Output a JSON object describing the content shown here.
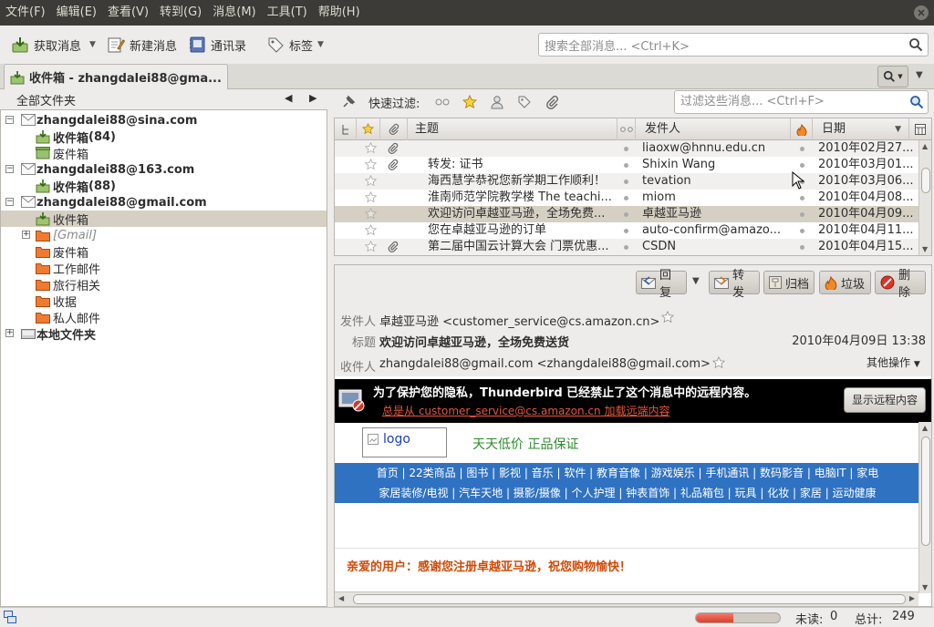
{
  "menubar": {
    "items": [
      "文件(F)",
      "编辑(E)",
      "查看(V)",
      "转到(G)",
      "消息(M)",
      "工具(T)",
      "帮助(H)"
    ]
  },
  "toolbar": {
    "get_messages": "获取消息",
    "new_message": "新建消息",
    "address_book": "通讯录",
    "tags": "标签",
    "search_placeholder": "搜索全部消息... <Ctrl+K>"
  },
  "tab": {
    "title": "收件箱 - zhangdalei88@gma..."
  },
  "folders": {
    "header": "全部文件夹",
    "rows": [
      {
        "label": "zhangdalei88@sina.com",
        "count": ""
      },
      {
        "label": "收件箱",
        "count": " (84)"
      },
      {
        "label": "废件箱",
        "count": ""
      },
      {
        "label": "zhangdalei88@163.com",
        "count": ""
      },
      {
        "label": "收件箱",
        "count": " (88)"
      },
      {
        "label": "zhangdalei88@gmail.com",
        "count": ""
      },
      {
        "label": "收件箱",
        "count": ""
      },
      {
        "label": "[Gmail]",
        "count": ""
      },
      {
        "label": "废件箱",
        "count": ""
      },
      {
        "label": "工作邮件",
        "count": ""
      },
      {
        "label": "旅行相关",
        "count": ""
      },
      {
        "label": "收据",
        "count": ""
      },
      {
        "label": "私人邮件",
        "count": ""
      },
      {
        "label": "本地文件夹",
        "count": ""
      }
    ]
  },
  "quick_filter": {
    "label": "快速过滤:",
    "search_placeholder": "过滤这些消息... <Ctrl+F>"
  },
  "thread_list": {
    "columns": {
      "subject": "主题",
      "sender": "发件人",
      "date": "日期"
    },
    "rows": [
      {
        "subject": "",
        "sender": "liaoxw@hnnu.edu.cn",
        "date": "2010年02月27...",
        "attachment": true
      },
      {
        "subject": "转发: 证书",
        "sender": "Shixin Wang",
        "date": "2010年03月01...",
        "attachment": true
      },
      {
        "subject": "海西慧学恭祝您新学期工作顺利！",
        "sender": "tevation",
        "date": "2010年03月06...",
        "attachment": false
      },
      {
        "subject": "淮南师范学院教学楼 The teachi...",
        "sender": "miom",
        "date": "2010年04月08...",
        "attachment": false
      },
      {
        "subject": "欢迎访问卓越亚马逊，全场免费...",
        "sender": "卓越亚马逊",
        "date": "2010年04月09...",
        "attachment": false
      },
      {
        "subject": "您在卓越亚马逊的订单",
        "sender": "auto-confirm@amazo...",
        "date": "2010年04月11...",
        "attachment": false
      },
      {
        "subject": "第二届中国云计算大会 门票优惠...",
        "sender": "CSDN",
        "date": "2010年04月15...",
        "attachment": true
      }
    ]
  },
  "message": {
    "buttons": {
      "reply": "回复",
      "forward": "转发",
      "archive": "归档",
      "junk": "垃圾",
      "delete": "删除"
    },
    "from_label": "发件人",
    "from_value": "卓越亚马逊 <customer_service@cs.amazon.cn>",
    "subject_label": "标题",
    "subject_value": "欢迎访问卓越亚马逊，全场免费送货",
    "date": "2010年04月09日 13:38",
    "to_label": "收件人",
    "to_value": "zhangdalei88@gmail.com <zhangdalei88@gmail.com>",
    "other_actions": "其他操作",
    "remote_notice": "为了保护您的隐私，Thunderbird 已经禁止了这个消息中的远程内容。",
    "remote_link": "总是从 customer_service@cs.amazon.cn 加载远端内容",
    "remote_button": "显示远程内容",
    "body": {
      "logo_alt": "logo",
      "slogan": "天天低价 正品保证",
      "nav_line1": "首页 | 22类商品 | 图书 | 影视 | 音乐 | 软件 | 教育音像 | 游戏娱乐 | 手机通讯 | 数码影音 | 电脑IT | 家电",
      "nav_line2": "家居装修/电视 | 汽车天地 | 摄影/摄像 | 个人护理 | 钟表首饰 | 礼品箱包 | 玩具 | 化妆 | 家居 | 运动健康",
      "greeting": "亲爱的用户：感谢您注册卓越亚马逊，祝您购物愉快！"
    }
  },
  "status": {
    "unread_label": "未读:",
    "unread": "0",
    "total_label": "总计:",
    "total": "249",
    "progress": 0.45
  },
  "colors": {
    "menubar_bg": "#3c3b37",
    "selection": "#d6d0c4",
    "nav_blue": "#2f72c2",
    "greeting_orange": "#d04a07",
    "link_red": "#e5563d"
  }
}
